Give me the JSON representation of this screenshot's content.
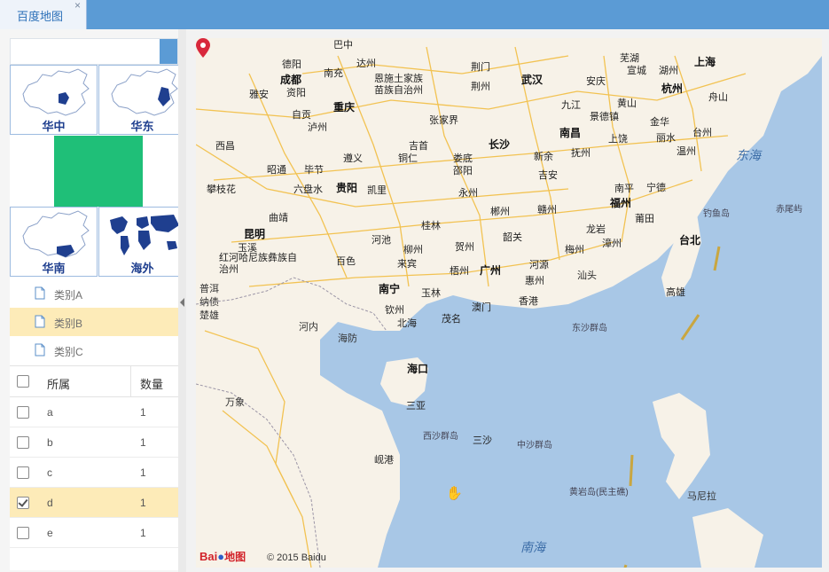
{
  "tab": {
    "label": "百度地图",
    "close": "×"
  },
  "regions": [
    {
      "label": "华中"
    },
    {
      "label": "华东"
    },
    {
      "label": "华南"
    },
    {
      "label": "海外"
    }
  ],
  "categories": [
    {
      "label": "类别A",
      "selected": false
    },
    {
      "label": "类别B",
      "selected": true
    },
    {
      "label": "类别C",
      "selected": false
    }
  ],
  "grid": {
    "headers": {
      "owner": "所属",
      "count": "数量"
    },
    "rows": [
      {
        "owner": "a",
        "count": "1",
        "checked": false
      },
      {
        "owner": "b",
        "count": "1",
        "checked": false
      },
      {
        "owner": "c",
        "count": "1",
        "checked": false
      },
      {
        "owner": "d",
        "count": "1",
        "checked": true
      },
      {
        "owner": "e",
        "count": "1",
        "checked": false
      }
    ]
  },
  "map": {
    "cities": [
      "巴中",
      "德阳",
      "达州",
      "南充",
      "成都",
      "恩施土家族苗族自治州",
      "荆门",
      "武汉",
      "荆州",
      "芜湖",
      "宣城",
      "湖州",
      "上海",
      "安庆",
      "杭州",
      "雅安",
      "资阳",
      "重庆",
      "九江",
      "黄山",
      "景德镇",
      "舟山",
      "自贡",
      "泸州",
      "张家界",
      "金华",
      "南昌",
      "丽水",
      "台州",
      "上饶",
      "西昌",
      "吉首",
      "长沙",
      "温州",
      "遵义",
      "铜仁",
      "娄底",
      "新余",
      "抚州",
      "昭通",
      "毕节",
      "邵阳",
      "吉安",
      "攀枝花",
      "六盘水",
      "贵阳",
      "凯里",
      "永州",
      "南平",
      "宁德",
      "曲靖",
      "郴州",
      "赣州",
      "福州",
      "桂林",
      "龙岩",
      "莆田",
      "昆明",
      "河池",
      "贺州",
      "韶关",
      "漳州",
      "玉溪",
      "柳州",
      "梅州",
      "红河哈尼族彝族自治州",
      "百色",
      "来宾",
      "梧州",
      "广州",
      "河源",
      "汕头",
      "惠州",
      "南宁",
      "玉林",
      "澳门",
      "香港",
      "钦州",
      "北海",
      "茂名",
      "高雄",
      "台北",
      "海防",
      "海口",
      "三亚",
      "西沙群岛",
      "三沙",
      "岘港",
      "马尼拉",
      "万象",
      "河内",
      "普洱",
      "纳债",
      "楚雄"
    ],
    "labels": {
      "sea_east": "东海",
      "sea_south": "南海",
      "diaoyu": "钓鱼岛",
      "chiwei": "赤尾屿",
      "dongsha": "东沙群岛",
      "zhongsha": "中沙群岛",
      "huangyan": "黄岩岛(民主礁)"
    },
    "logo_text": "Bai",
    "logo_suffix": "地图",
    "copyright": "© 2015 Baidu"
  }
}
